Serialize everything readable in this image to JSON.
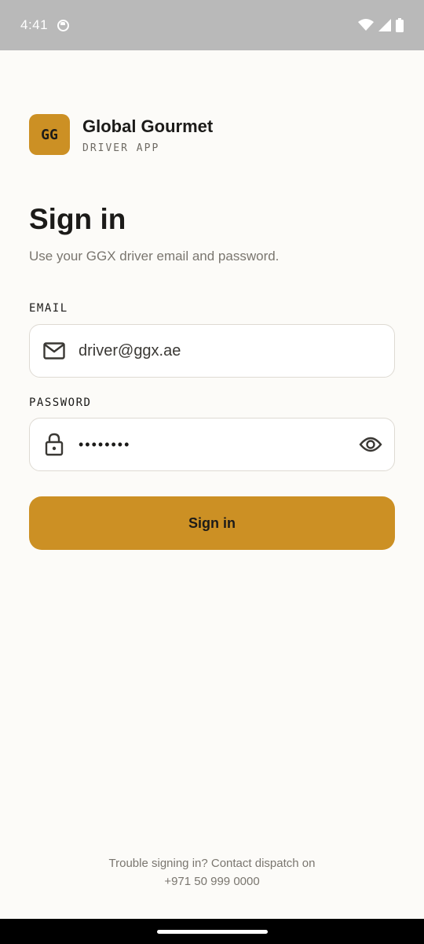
{
  "status_bar": {
    "time": "4:41"
  },
  "brand": {
    "logo_text": "GG",
    "name": "Global Gourmet",
    "subtitle": "DRIVER APP"
  },
  "page": {
    "title": "Sign in",
    "subtitle": "Use your GGX driver email and password."
  },
  "form": {
    "email": {
      "label": "EMAIL",
      "value": "driver@ggx.ae",
      "icon": "mail-icon"
    },
    "password": {
      "label": "PASSWORD",
      "value": "••••••••",
      "icon": "lock-icon",
      "toggle_icon": "eye-icon"
    },
    "submit_label": "Sign in"
  },
  "help": {
    "line1": "Trouble signing in? Contact dispatch on",
    "phone": "+971 50 999 0000"
  },
  "colors": {
    "accent": "#cc9024",
    "background": "#fcfbf8",
    "text": "#1c1b19",
    "muted": "#7a766f"
  }
}
